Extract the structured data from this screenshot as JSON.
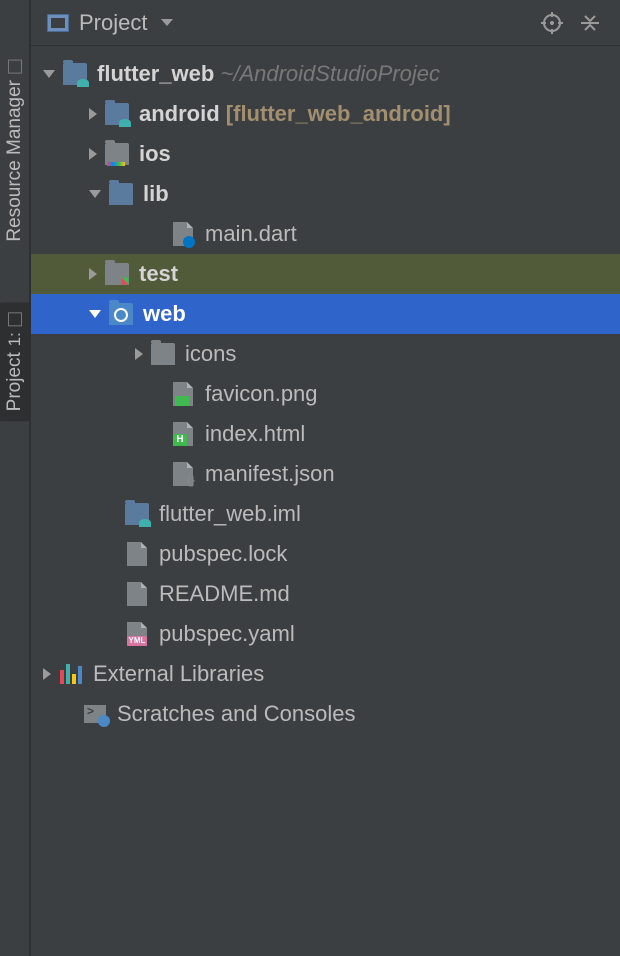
{
  "toolbar": {
    "title": "Project"
  },
  "sideTabs": {
    "resourceManager": "Resource Manager",
    "project": "Project",
    "projectNum": "1:"
  },
  "tree": {
    "root": {
      "name": "flutter_web",
      "path": "~/AndroidStudioProjec"
    },
    "android": {
      "name": "android",
      "module": "[flutter_web_android]"
    },
    "ios": "ios",
    "lib": "lib",
    "mainDart": "main.dart",
    "test": "test",
    "web": "web",
    "icons": "icons",
    "favicon": "favicon.png",
    "indexHtml": "index.html",
    "manifest": "manifest.json",
    "iml": "flutter_web.iml",
    "pubspecLock": "pubspec.lock",
    "readme": "README.md",
    "pubspecYaml": "pubspec.yaml",
    "externalLibs": "External Libraries",
    "scratches": "Scratches and Consoles"
  }
}
